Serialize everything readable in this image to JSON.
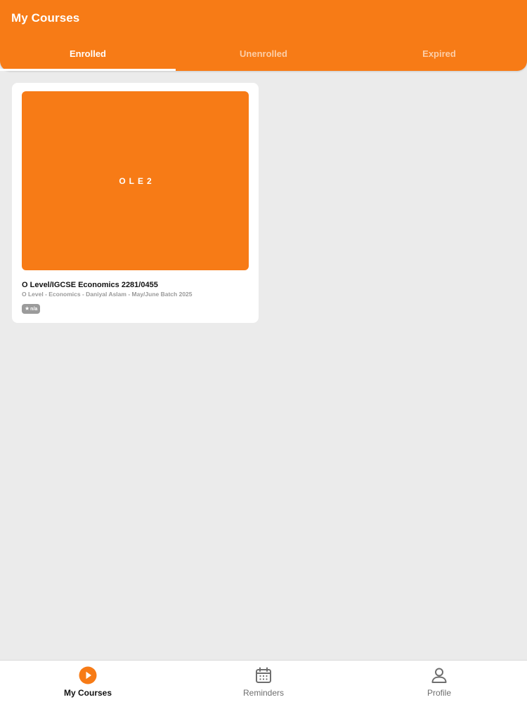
{
  "header": {
    "title": "My Courses",
    "tabs": [
      {
        "label": "Enrolled",
        "active": true
      },
      {
        "label": "Unenrolled",
        "active": false
      },
      {
        "label": "Expired",
        "active": false
      }
    ]
  },
  "courses": [
    {
      "thumbnail_text": "OLE2",
      "title": "O Level/IGCSE Economics 2281/0455",
      "subtitle": "O Level - Economics - Daniyal Aslam - May/June Batch 2025",
      "rating": "n/a"
    }
  ],
  "bottom_nav": {
    "items": [
      {
        "label": "My Courses",
        "icon": "play-circle-icon",
        "active": true
      },
      {
        "label": "Reminders",
        "icon": "calendar-icon",
        "active": false
      },
      {
        "label": "Profile",
        "icon": "person-icon",
        "active": false
      }
    ]
  },
  "colors": {
    "brand": "#f77b16",
    "background": "#ebebeb",
    "card": "#ffffff",
    "badge": "#9b9b9b"
  }
}
